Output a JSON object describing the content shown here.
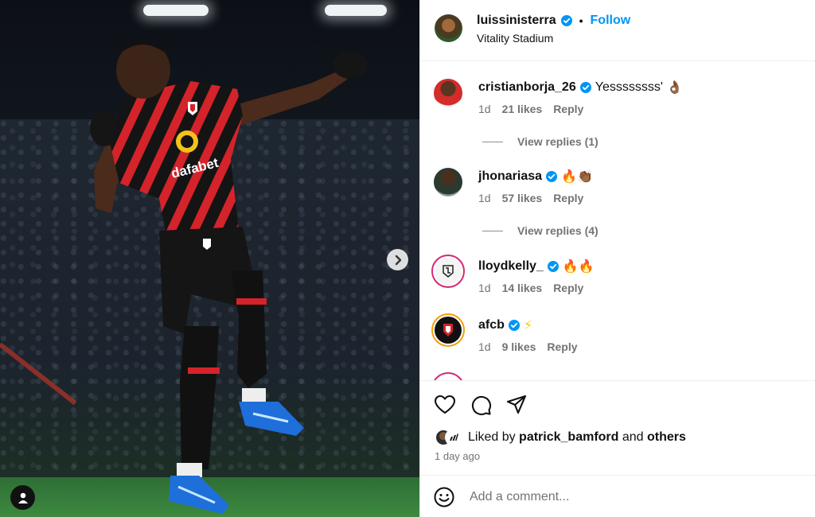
{
  "post": {
    "username": "luissinisterra",
    "follow_label": "Follow",
    "separator": "•",
    "location": "Vitality Stadium",
    "sponsor_text": "dafabet"
  },
  "comments": [
    {
      "username": "cristianborja_26",
      "text": "Yessssssss'",
      "emoji": "👌🏾",
      "time": "1d",
      "likes": "21 likes",
      "reply": "Reply",
      "view_replies": "View replies (1)"
    },
    {
      "username": "jhonariasa",
      "text": "",
      "emoji": "🔥👏🏾",
      "time": "1d",
      "likes": "57 likes",
      "reply": "Reply",
      "view_replies": "View replies (4)"
    },
    {
      "username": "lloydkelly_",
      "text": "",
      "emoji": "🔥🔥",
      "time": "1d",
      "likes": "14 likes",
      "reply": "Reply",
      "view_replies": ""
    },
    {
      "username": "afcb",
      "text": "",
      "emoji": "⚡",
      "time": "1d",
      "likes": "9 likes",
      "reply": "Reply",
      "view_replies": ""
    }
  ],
  "likes": {
    "prefix": "Liked by",
    "user": "patrick_bamford",
    "conjunction": "and",
    "others": "others",
    "time_ago": "1 day ago"
  },
  "add_comment": {
    "placeholder": "Add a comment..."
  },
  "colors": {
    "accent": "#0095f6",
    "muted": "#737373",
    "kit_red": "#d4232a",
    "kit_black": "#111111"
  },
  "icons": [
    "verified-icon",
    "heart-icon",
    "comment-icon",
    "share-icon",
    "emoji-icon",
    "chevron-right-icon",
    "user-tag-icon"
  ]
}
